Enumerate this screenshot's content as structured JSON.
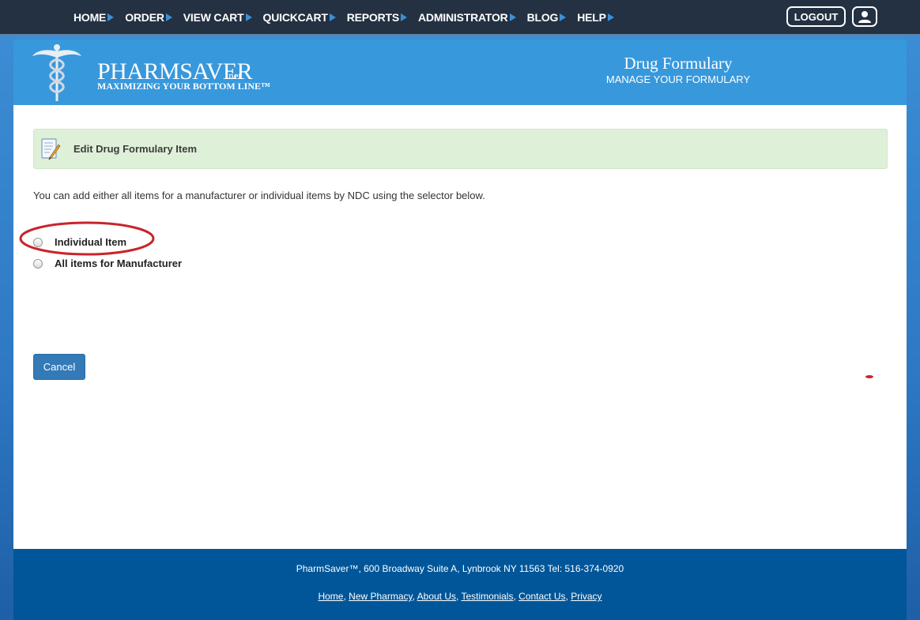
{
  "nav": {
    "items": [
      {
        "label": "HOME"
      },
      {
        "label": "ORDER"
      },
      {
        "label": "VIEW CART"
      },
      {
        "label": "QUICKCART"
      },
      {
        "label": "REPORTS"
      },
      {
        "label": "ADMINISTRATOR"
      },
      {
        "label": "BLOG"
      },
      {
        "label": "HELP"
      }
    ],
    "logout_label": "LOGOUT",
    "user_icon": "user-icon"
  },
  "brand": {
    "name": "PHARMSAVER",
    "suffix": ".net",
    "tagline": "MAXIMIZING YOUR BOTTOM LINE™"
  },
  "header": {
    "title": "Drug Formulary",
    "subtitle": "MANAGE YOUR FORMULARY"
  },
  "main": {
    "alert_title": "Edit Drug Formulary Item",
    "alert_icon": "edit-document-icon",
    "intro": "You can add either all items for a manufacturer or individual items by NDC using the selector below.",
    "options": [
      {
        "label": "Individual Item"
      },
      {
        "label": "All items for Manufacturer"
      }
    ],
    "cancel_label": "Cancel"
  },
  "footer": {
    "address": "PharmSaver™, 600 Broadway Suite A, Lynbrook NY 11563 Tel: 516-374-0920",
    "links": [
      {
        "label": "Home"
      },
      {
        "label": "New Pharmacy"
      },
      {
        "label": "About Us"
      },
      {
        "label": "Testimonials"
      },
      {
        "label": "Contact Us"
      },
      {
        "label": "Privacy"
      }
    ]
  },
  "colors": {
    "topbar": "#233142",
    "banner": "#3898dc",
    "alert_bg": "#dff0d8",
    "button": "#337ab7",
    "footer": "#005699",
    "annotation_red": "#c8242a"
  }
}
